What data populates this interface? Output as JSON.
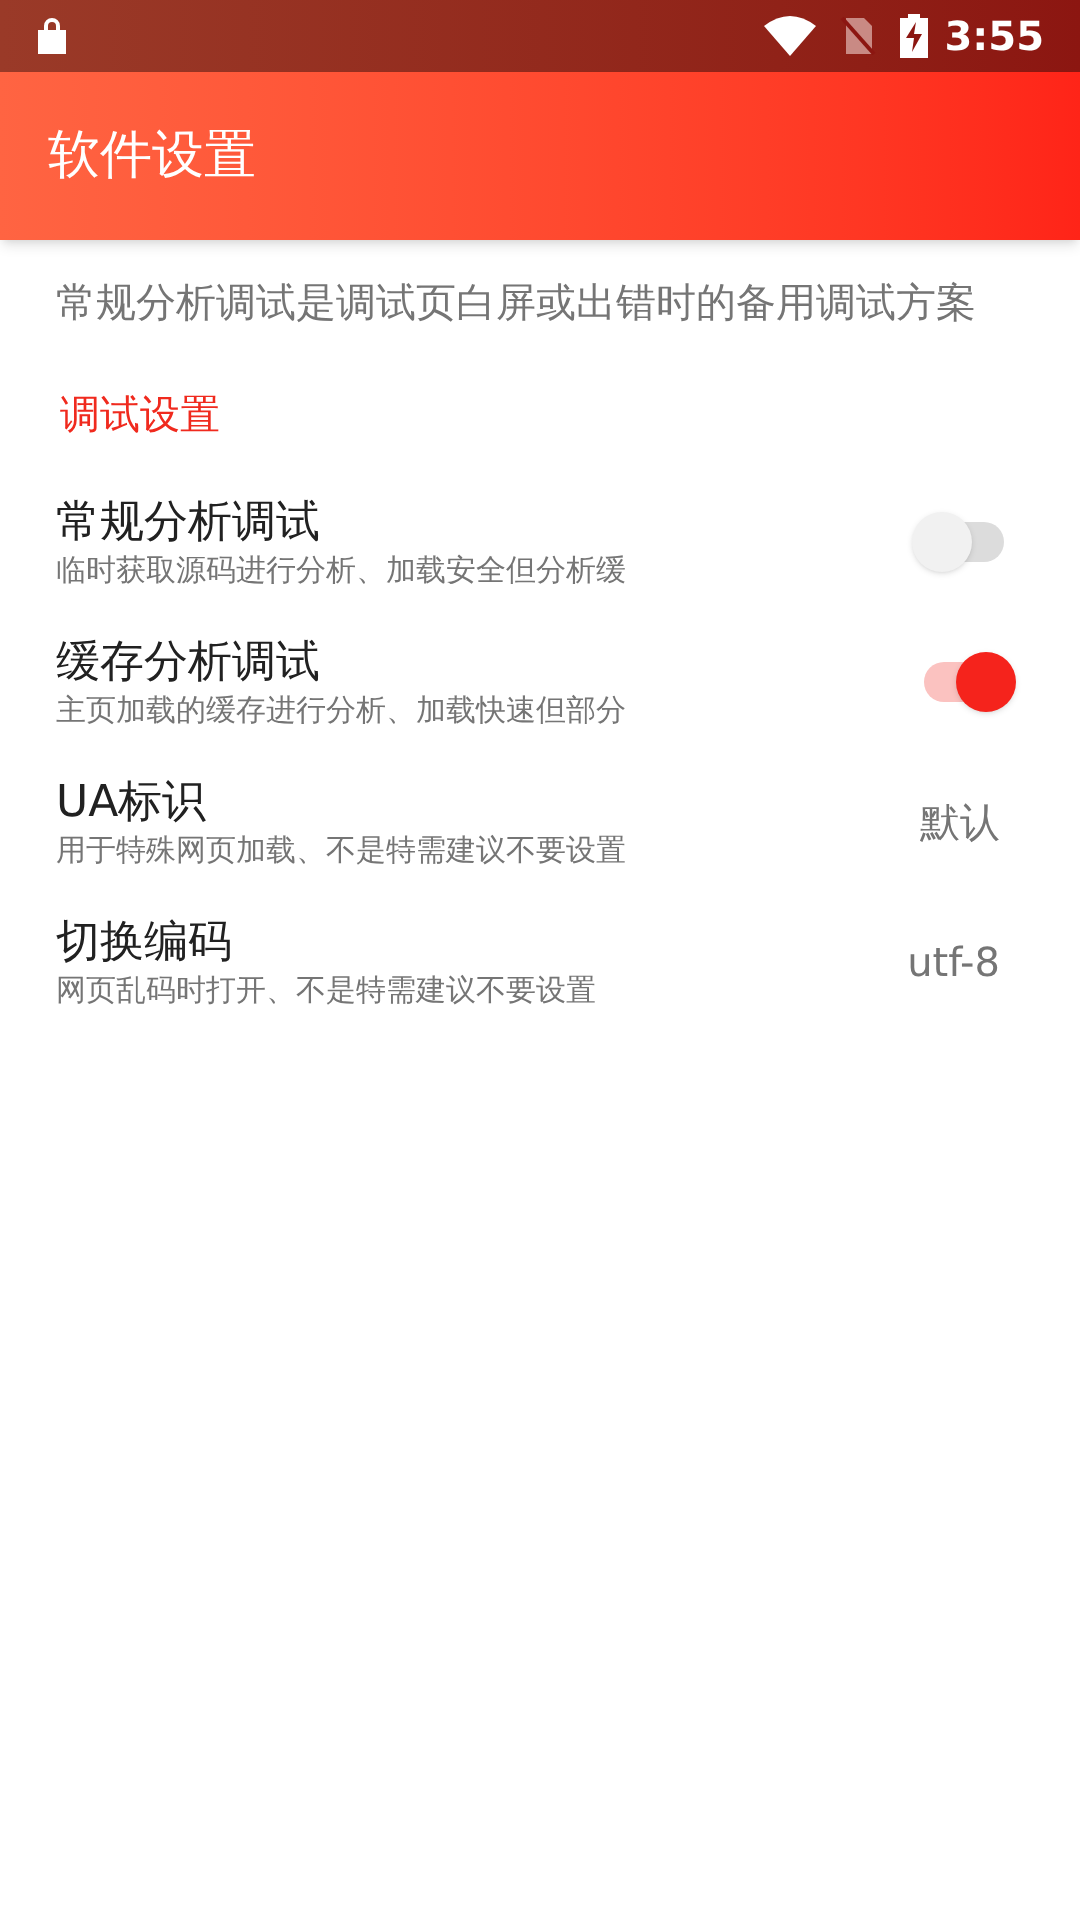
{
  "status_bar": {
    "time": "3:55"
  },
  "app_bar": {
    "title": "软件设置"
  },
  "description": "常规分析调试是调试页白屏或出错时的备用调试方案",
  "section": {
    "title": "调试设置"
  },
  "settings": [
    {
      "kind": "switch",
      "title": "常规分析调试",
      "subtitle": "临时获取源码进行分析、加载安全但分析缓",
      "on": false
    },
    {
      "kind": "switch",
      "title": "缓存分析调试",
      "subtitle": "主页加载的缓存进行分析、加载快速但部分",
      "on": true
    },
    {
      "kind": "value",
      "title": "UA标识",
      "subtitle": "用于特殊网页加载、不是特需建议不要设置",
      "value": "默认"
    },
    {
      "kind": "value",
      "title": "切换编码",
      "subtitle": "网页乱码时打开、不是特需建议不要设置",
      "value": "utf-8"
    }
  ]
}
